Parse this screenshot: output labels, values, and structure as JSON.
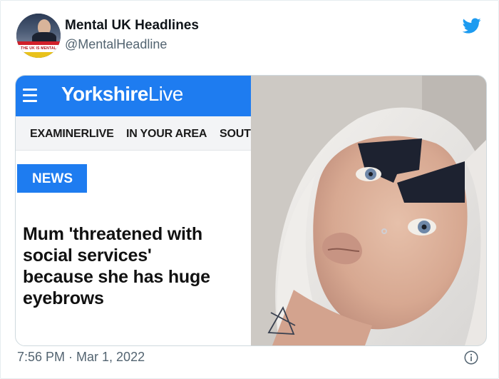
{
  "account": {
    "name": "Mental UK Headlines",
    "handle": "@MentalHeadline",
    "avatar_banner_text": "THE UK IS MENTAL"
  },
  "media": {
    "site_logo_bold": "Yorkshire",
    "site_logo_light": "Live",
    "nav_items": [
      "EXAMINERLIVE",
      "IN YOUR AREA",
      "SOUT"
    ],
    "section_badge": "NEWS",
    "headline_lines": [
      "Mum 'threatened with",
      "social services'",
      "because she has huge",
      "eyebrows"
    ]
  },
  "footer": {
    "timestamp": "7:56 PM · Mar 1, 2022"
  },
  "icons": {
    "brand": "twitter-bird-icon",
    "menu": "hamburger-menu-icon",
    "info": "info-icon"
  },
  "colors": {
    "twitter_blue": "#1d9bf0",
    "yorkshire_blue": "#1e7cf0",
    "muted_text": "#536471"
  }
}
